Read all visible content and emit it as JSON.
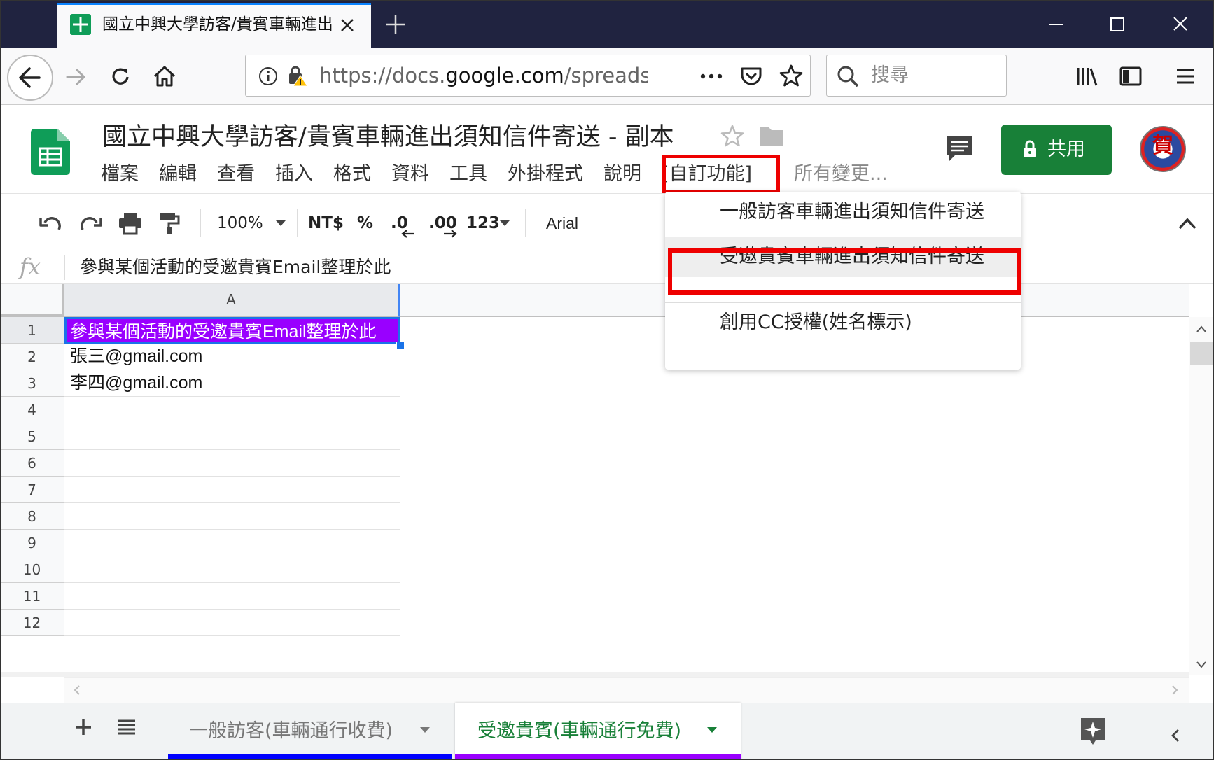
{
  "browser": {
    "tab_title": "國立中興大學訪客/貴賓車輛進出須知信件寄送 - 副本",
    "url_prefix": "https://docs.",
    "url_domain": "google.com",
    "url_suffix": "/spreadshe",
    "search_placeholder": "搜尋"
  },
  "sheets": {
    "title": "國立中興大學訪客/貴賓車輛進出須知信件寄送 - 副本",
    "menus": [
      "檔案",
      "編輯",
      "查看",
      "插入",
      "格式",
      "資料",
      "工具",
      "外掛程式",
      "說明"
    ],
    "custom_menu": "[自訂功能]",
    "all_changes": "所有變更...",
    "share_label": "共用",
    "avatar_text": "賀"
  },
  "toolbar": {
    "zoom": "100%",
    "currency": "NT$",
    "percent": "%",
    "decimal_decrease": ".0",
    "decimal_increase": ".00",
    "more_formats": "123",
    "font": "Arial"
  },
  "formula_bar": {
    "fx_label": "fx",
    "content": "參與某個活動的受邀貴賓Email整理於此"
  },
  "grid": {
    "column_header": "A",
    "rows": [
      {
        "num": "1",
        "value": "參與某個活動的受邀貴賓Email整理於此"
      },
      {
        "num": "2",
        "value": "張三@gmail.com"
      },
      {
        "num": "3",
        "value": "李四@gmail.com"
      },
      {
        "num": "4",
        "value": ""
      },
      {
        "num": "5",
        "value": ""
      },
      {
        "num": "6",
        "value": ""
      },
      {
        "num": "7",
        "value": ""
      },
      {
        "num": "8",
        "value": ""
      },
      {
        "num": "9",
        "value": ""
      },
      {
        "num": "10",
        "value": ""
      },
      {
        "num": "11",
        "value": ""
      },
      {
        "num": "12",
        "value": ""
      }
    ],
    "selected_fill_color": "#9900ff"
  },
  "dropdown": {
    "items": [
      "一般訪客車輛進出須知信件寄送",
      "受邀貴賓車輛進出須知信件寄送",
      "創用CC授權(姓名標示)"
    ]
  },
  "sheet_tabs": [
    {
      "label": "一般訪客(車輛通行收費)",
      "color": "#0000ff"
    },
    {
      "label": "受邀貴賓(車輛通行免費)",
      "color": "#9900ff"
    }
  ],
  "colors": {
    "highlight_box": "#ee0000",
    "share_green": "#188038",
    "sheets_green": "#0f9d58"
  }
}
